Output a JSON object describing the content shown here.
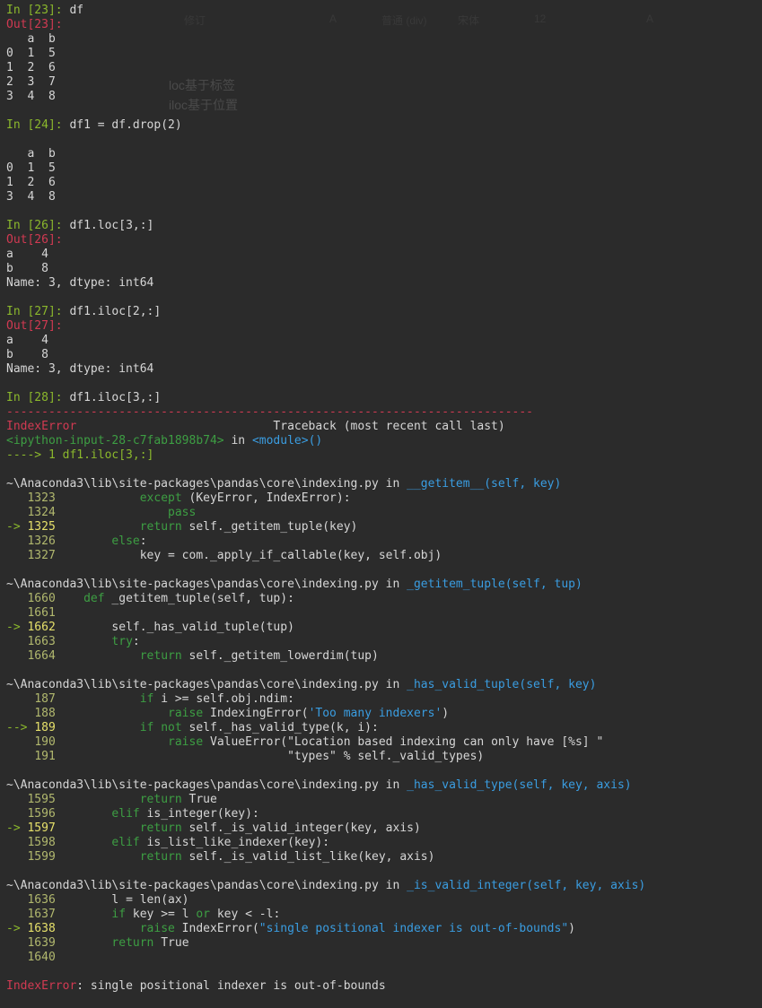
{
  "cells": {
    "c23": {
      "in_prompt": "In [23]:",
      "code": "df",
      "out_prompt": "Out[23]:",
      "table_header": "   a  b",
      "table_rows": [
        "0  1  5",
        "1  2  6",
        "2  3  7",
        "3  4  8"
      ]
    },
    "c24": {
      "in_prompt": "In [24]:",
      "code": "df1 = df.drop(2)",
      "table_header": "   a  b",
      "table_rows": [
        "0  1  5",
        "1  2  6",
        "3  4  8"
      ]
    },
    "c26": {
      "in_prompt": "In [26]:",
      "code": "df1.loc[3,:]",
      "out_prompt": "Out[26]:",
      "rows": [
        "a    4",
        "b    8",
        "Name: 3, dtype: int64"
      ]
    },
    "c27": {
      "in_prompt": "In [27]:",
      "code": "df1.iloc[2,:]",
      "out_prompt": "Out[27]:",
      "rows": [
        "a    4",
        "b    8",
        "Name: 3, dtype: int64"
      ]
    },
    "c28": {
      "in_prompt": "In [28]:",
      "code": "df1.iloc[3,:]"
    }
  },
  "traceback": {
    "separator": "---------------------------------------------------------------------------",
    "error_name": "IndexError",
    "header_right": "                            Traceback (most recent call last)",
    "input_ref": "<ipython-input-28-c7fab1898b74>",
    "in_word": " in ",
    "module": "<module>()",
    "arrow_line": "----> 1 df1.iloc[3,:]",
    "frames": [
      {
        "path": "~\\Anaconda3\\lib\\site-packages\\pandas\\core\\indexing.py",
        "func": "__getitem__(self, key)",
        "lines": [
          {
            "mark": "   ",
            "num": "1323",
            "pre": "            ",
            "kw": "except",
            "rest": " (KeyError, IndexError):"
          },
          {
            "mark": "   ",
            "num": "1324",
            "pre": "                ",
            "kw": "pass",
            "rest": ""
          },
          {
            "mark": "-> ",
            "num": "1325",
            "pre": "            ",
            "kw": "return",
            "rest": " self._getitem_tuple(key)"
          },
          {
            "mark": "   ",
            "num": "1326",
            "pre": "        ",
            "kw": "else",
            "rest": ":"
          },
          {
            "mark": "   ",
            "num": "1327",
            "pre": "            key = com._apply_if_callable(key, self.obj)",
            "kw": "",
            "rest": ""
          }
        ]
      },
      {
        "path": "~\\Anaconda3\\lib\\site-packages\\pandas\\core\\indexing.py",
        "func": "_getitem_tuple(self, tup)",
        "lines": [
          {
            "mark": "   ",
            "num": "1660",
            "pre": "    ",
            "kw": "def",
            "rest": " _getitem_tuple(self, tup):"
          },
          {
            "mark": "   ",
            "num": "1661",
            "pre": "",
            "kw": "",
            "rest": ""
          },
          {
            "mark": "-> ",
            "num": "1662",
            "pre": "        self._has_valid_tuple(tup)",
            "kw": "",
            "rest": ""
          },
          {
            "mark": "   ",
            "num": "1663",
            "pre": "        ",
            "kw": "try",
            "rest": ":"
          },
          {
            "mark": "   ",
            "num": "1664",
            "pre": "            ",
            "kw": "return",
            "rest": " self._getitem_lowerdim(tup)"
          }
        ]
      },
      {
        "path": "~\\Anaconda3\\lib\\site-packages\\pandas\\core\\indexing.py",
        "func": "_has_valid_tuple(self, key)",
        "lines": [
          {
            "mark": "    ",
            "num": "187",
            "pre": "            ",
            "kw": "if",
            "rest": " i >= self.obj.ndim:"
          },
          {
            "mark": "    ",
            "num": "188",
            "pre": "                ",
            "kw": "raise",
            "rest": " IndexingError(",
            "str": "'Too many indexers'",
            "tail": ")"
          },
          {
            "mark": "--> ",
            "num": "189",
            "pre": "            ",
            "kw": "if not",
            "rest": " self._has_valid_type(k, i):"
          },
          {
            "mark": "    ",
            "num": "190",
            "pre": "                ",
            "kw": "raise",
            "rest": " ValueError(\"Location based indexing can only have [%s] \""
          },
          {
            "mark": "    ",
            "num": "191",
            "pre": "                                 \"types\" % self._valid_types)",
            "kw": "",
            "rest": ""
          }
        ]
      },
      {
        "path": "~\\Anaconda3\\lib\\site-packages\\pandas\\core\\indexing.py",
        "func": "_has_valid_type(self, key, axis)",
        "lines": [
          {
            "mark": "   ",
            "num": "1595",
            "pre": "            ",
            "kw": "return",
            "rest": " True"
          },
          {
            "mark": "   ",
            "num": "1596",
            "pre": "        ",
            "kw": "elif",
            "rest": " is_integer(key):"
          },
          {
            "mark": "-> ",
            "num": "1597",
            "pre": "            ",
            "kw": "return",
            "rest": " self._is_valid_integer(key, axis)"
          },
          {
            "mark": "   ",
            "num": "1598",
            "pre": "        ",
            "kw": "elif",
            "rest": " is_list_like_indexer(key):"
          },
          {
            "mark": "   ",
            "num": "1599",
            "pre": "            ",
            "kw": "return",
            "rest": " self._is_valid_list_like(key, axis)"
          }
        ]
      },
      {
        "path": "~\\Anaconda3\\lib\\site-packages\\pandas\\core\\indexing.py",
        "func": "_is_valid_integer(self, key, axis)",
        "lines": [
          {
            "mark": "   ",
            "num": "1636",
            "pre": "        l = len(ax)",
            "kw": "",
            "rest": ""
          },
          {
            "mark": "   ",
            "num": "1637",
            "pre": "        ",
            "kw": "if",
            "rest": " key >= l ",
            "kw2": "or",
            "rest2": " key < -l:"
          },
          {
            "mark": "-> ",
            "num": "1638",
            "pre": "            ",
            "kw": "raise",
            "rest": " IndexError(",
            "str": "\"single positional indexer is out-of-bounds\"",
            "tail": ")"
          },
          {
            "mark": "   ",
            "num": "1639",
            "pre": "        ",
            "kw": "return",
            "rest": " True"
          },
          {
            "mark": "   ",
            "num": "1640",
            "pre": "",
            "kw": "",
            "rest": ""
          }
        ]
      }
    ],
    "final_error": "IndexError",
    "final_message": ": single positional indexer is out-of-bounds"
  },
  "ghost": {
    "toolbar": [
      "修订",
      "A",
      "普通 (div)",
      "宋体",
      "12",
      "A"
    ],
    "notes": [
      "loc基于标签",
      "iloc基于位置"
    ]
  }
}
